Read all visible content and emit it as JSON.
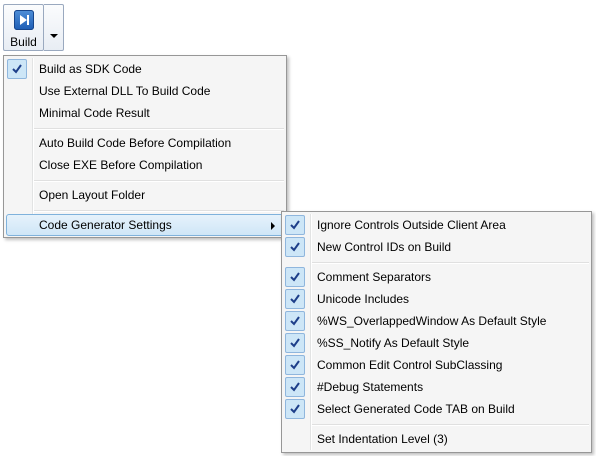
{
  "toolbar": {
    "build_label": "Build",
    "build_icon": "play-step-icon",
    "accent": "#2a6fca"
  },
  "main_menu": {
    "items": [
      {
        "label": "Build as SDK Code",
        "checked": true
      },
      {
        "label": "Use External DLL To Build Code",
        "checked": false
      },
      {
        "label": "Minimal Code Result",
        "checked": false
      },
      {
        "label": "Auto Build Code Before Compilation",
        "checked": false
      },
      {
        "label": "Close EXE Before Compilation",
        "checked": false
      },
      {
        "label": "Open Layout Folder",
        "checked": false
      },
      {
        "label": "Code Generator Settings",
        "checked": false,
        "has_submenu": true,
        "highlighted": true
      }
    ]
  },
  "sub_menu": {
    "items": [
      {
        "label": "Ignore Controls Outside Client Area",
        "checked": true
      },
      {
        "label": "New Control IDs on Build",
        "checked": true
      },
      {
        "label": "Comment Separators",
        "checked": true
      },
      {
        "label": "Unicode Includes",
        "checked": true
      },
      {
        "label": "%WS_OverlappedWindow As Default Style",
        "checked": true
      },
      {
        "label": "%SS_Notify As Default Style",
        "checked": true
      },
      {
        "label": "Common Edit Control SubClassing",
        "checked": true
      },
      {
        "label": "#Debug Statements",
        "checked": true
      },
      {
        "label": "Select Generated Code TAB on Build",
        "checked": true
      },
      {
        "label": "Set Indentation Level (3)",
        "checked": false
      }
    ]
  }
}
